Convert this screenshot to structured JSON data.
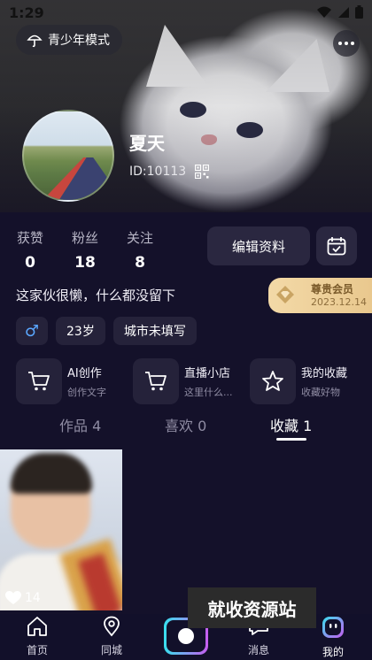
{
  "status_bar": {
    "time": "1:29"
  },
  "header": {
    "teen_mode_label": "青少年模式",
    "username": "夏天",
    "user_id": "ID:10113"
  },
  "stats": [
    {
      "label": "获赞",
      "value": "0"
    },
    {
      "label": "粉丝",
      "value": "18"
    },
    {
      "label": "关注",
      "value": "8"
    }
  ],
  "actions": {
    "edit_profile_label": "编辑资料"
  },
  "bio": "这家伙很懒，什么都没留下",
  "vip": {
    "title": "尊贵会员",
    "date": "2023.12.14"
  },
  "tags": {
    "gender_symbol": "♂",
    "age": "23岁",
    "city": "城市未填写"
  },
  "features": [
    {
      "title": "AI创作",
      "subtitle": "创作文字",
      "icon": "cart-icon"
    },
    {
      "title": "直播小店",
      "subtitle": "这里什么...",
      "icon": "cart-icon"
    },
    {
      "title": "我的收藏",
      "subtitle": "收藏好物",
      "icon": "star-icon"
    }
  ],
  "content_tabs": [
    {
      "label": "作品 4"
    },
    {
      "label": "喜欢 0"
    },
    {
      "label": "收藏 1",
      "active": true
    }
  ],
  "grid": [
    {
      "likes": "14"
    }
  ],
  "watermark": "就收资源站",
  "bottom_nav": [
    {
      "label": "首页"
    },
    {
      "label": "同城"
    },
    {
      "label": ""
    },
    {
      "label": "消息"
    },
    {
      "label": "我的",
      "active": true
    }
  ],
  "colors": {
    "background": "#14112a",
    "accent_gold": "#e9c88e",
    "camera_gradient_start": "#38e0ee",
    "camera_gradient_end": "#c75cf0"
  }
}
